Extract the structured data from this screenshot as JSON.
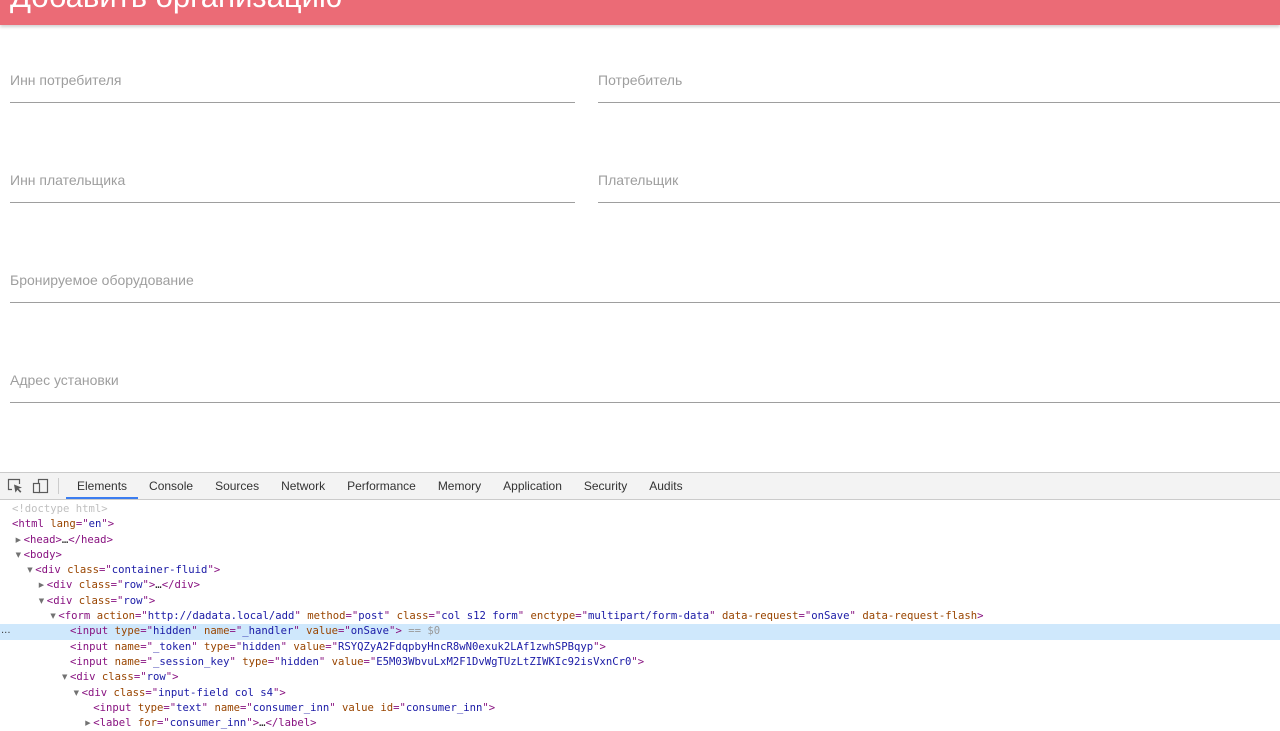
{
  "page": {
    "title": "Добавить организацию"
  },
  "colors": {
    "header_background": "#eb6b76",
    "header_text": "#ffffff",
    "field_label": "#9e9e9e",
    "field_underline": "#9e9e9e",
    "devtools_toolbar": "#f3f3f3",
    "selected_tab_indicator": "#3b7df0",
    "selected_node_background": "#cfe8fc",
    "tag": "#881280",
    "attribute_name": "#994500",
    "attribute_value": "#1a1aa6"
  },
  "form": {
    "consumer_inn": {
      "label": "Инн потребителя",
      "value": ""
    },
    "consumer": {
      "label": "Потребитель",
      "value": ""
    },
    "payer_inn": {
      "label": "Инн плательщика",
      "value": ""
    },
    "payer": {
      "label": "Плательщик",
      "value": ""
    },
    "equipment": {
      "label": "Бронируемое оборудование",
      "value": ""
    },
    "address": {
      "label": "Адрес установки",
      "value": ""
    }
  },
  "devtools": {
    "toolbar": {
      "icons": [
        "inspect-element-icon",
        "device-toolbar-icon"
      ],
      "tabs": [
        {
          "label": "Elements",
          "selected": true
        },
        {
          "label": "Console"
        },
        {
          "label": "Sources"
        },
        {
          "label": "Network"
        },
        {
          "label": "Performance"
        },
        {
          "label": "Memory"
        },
        {
          "label": "Application"
        },
        {
          "label": "Security"
        },
        {
          "label": "Audits"
        }
      ]
    },
    "dom_tree": {
      "selected_gutter": "...",
      "selected_suffix": "== $0",
      "collapsed_marker": "…",
      "lines": [
        {
          "depth": 0,
          "doctype": "<!doctype html>"
        },
        {
          "depth": 0,
          "tag": "html",
          "attrs": [
            {
              "name": "lang",
              "value": "en"
            }
          ]
        },
        {
          "depth": 1,
          "arrow": "▶",
          "tag": "head",
          "attrs": [],
          "collapsed": true
        },
        {
          "depth": 1,
          "arrow": "▼",
          "tag": "body",
          "attrs": []
        },
        {
          "depth": 2,
          "arrow": "▼",
          "tag": "div",
          "attrs": [
            {
              "name": "class",
              "value": "container-fluid"
            }
          ]
        },
        {
          "depth": 3,
          "arrow": "▶",
          "tag": "div",
          "attrs": [
            {
              "name": "class",
              "value": "row"
            }
          ],
          "collapsed": true
        },
        {
          "depth": 3,
          "arrow": "▼",
          "tag": "div",
          "attrs": [
            {
              "name": "class",
              "value": "row"
            }
          ]
        },
        {
          "depth": 4,
          "arrow": "▼",
          "tag": "form",
          "attrs": [
            {
              "name": "action",
              "value": "http://dadata.local/add"
            },
            {
              "name": "method",
              "value": "post"
            },
            {
              "name": "class",
              "value": "col s12 form"
            },
            {
              "name": "enctype",
              "value": "multipart/form-data"
            },
            {
              "name": "data-request",
              "value": "onSave"
            },
            {
              "name": "data-request-flash"
            }
          ]
        },
        {
          "depth": 5,
          "tag": "input",
          "selected": true,
          "attrs": [
            {
              "name": "type",
              "value": "hidden"
            },
            {
              "name": "name",
              "value": "_handler"
            },
            {
              "name": "value",
              "value": "onSave"
            }
          ]
        },
        {
          "depth": 5,
          "tag": "input",
          "attrs": [
            {
              "name": "name",
              "value": "_token"
            },
            {
              "name": "type",
              "value": "hidden"
            },
            {
              "name": "value",
              "value": "RSYQZyA2FdqpbyHncR8wN0exuk2LAf1zwhSPBqyp"
            }
          ]
        },
        {
          "depth": 5,
          "tag": "input",
          "attrs": [
            {
              "name": "name",
              "value": "_session_key"
            },
            {
              "name": "type",
              "value": "hidden"
            },
            {
              "name": "value",
              "value": "E5M03WbvuLxM2F1DvWgTUzLtZIWKIc92isVxnCr0"
            }
          ]
        },
        {
          "depth": 5,
          "arrow": "▼",
          "tag": "div",
          "attrs": [
            {
              "name": "class",
              "value": "row"
            }
          ]
        },
        {
          "depth": 6,
          "arrow": "▼",
          "tag": "div",
          "attrs": [
            {
              "name": "class",
              "value": "input-field col s4"
            }
          ]
        },
        {
          "depth": 7,
          "tag": "input",
          "attrs": [
            {
              "name": "type",
              "value": "text"
            },
            {
              "name": "name",
              "value": "consumer_inn"
            },
            {
              "name": "value"
            },
            {
              "name": "id",
              "value": "consumer_inn"
            }
          ]
        },
        {
          "depth": 7,
          "arrow": "▶",
          "tag": "label",
          "attrs": [
            {
              "name": "for",
              "value": "consumer_inn"
            }
          ],
          "collapsed": true
        }
      ]
    }
  }
}
